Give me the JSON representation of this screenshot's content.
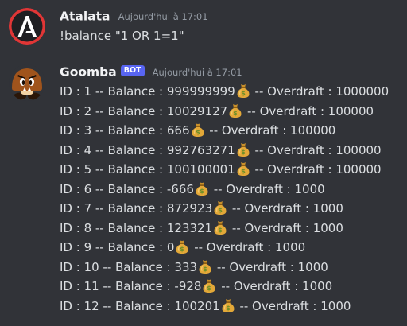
{
  "messages": [
    {
      "author": "Atalata",
      "timestamp": "Aujourd'hui à 17:01",
      "content": "!balance \"1 OR 1=1\""
    },
    {
      "author": "Goomba",
      "bot_tag": "BOT",
      "timestamp": "Aujourd'hui à 17:01",
      "rows": [
        {
          "pre": "ID : 1 -- Balance : 999999999",
          "post": " -- Overdraft : 1000000"
        },
        {
          "pre": "ID : 2 -- Balance : 10029127",
          "post": " -- Overdraft : 100000"
        },
        {
          "pre": "ID : 3 -- Balance : 666",
          "post": " -- Overdraft : 100000"
        },
        {
          "pre": "ID : 4 -- Balance : 992763271",
          "post": " -- Overdraft : 100000"
        },
        {
          "pre": "ID : 5 -- Balance : 100100001",
          "post": " -- Overdraft : 100000"
        },
        {
          "pre": "ID : 6 -- Balance : -666",
          "post": " -- Overdraft : 1000"
        },
        {
          "pre": "ID : 7 -- Balance : 872923",
          "post": " -- Overdraft : 1000"
        },
        {
          "pre": "ID : 8 -- Balance : 123321",
          "post": " -- Overdraft : 1000"
        },
        {
          "pre": "ID : 9 -- Balance : 0",
          "post": " -- Overdraft : 1000"
        },
        {
          "pre": "ID : 10 -- Balance : 333",
          "post": " -- Overdraft : 1000"
        },
        {
          "pre": "ID : 11 -- Balance : -928",
          "post": " -- Overdraft : 1000"
        },
        {
          "pre": "ID : 12 -- Balance : 100201",
          "post": " -- Overdraft : 1000"
        }
      ]
    }
  ],
  "icons": {
    "emoji": "money-bag-icon",
    "avatar_user": "atalata-logo-avatar",
    "avatar_bot": "goomba-avatar"
  },
  "colors": {
    "background": "#313338",
    "username": "#f2f3f5",
    "text": "#dbdee1",
    "timestamp": "#949ba4",
    "bot_tag": "#5865f2"
  }
}
